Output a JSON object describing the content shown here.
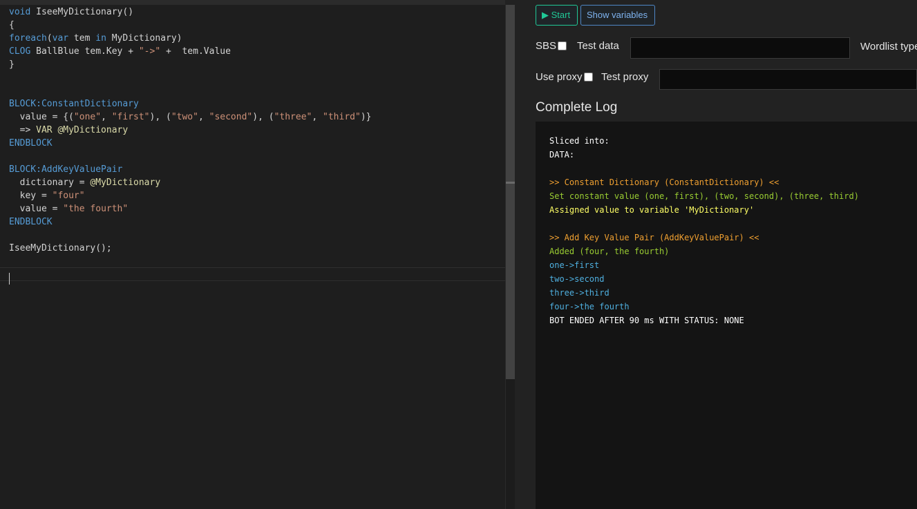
{
  "editor": {
    "lines": [
      [
        {
          "t": "void ",
          "c": "kw"
        },
        {
          "t": "IseeMyDictionary()",
          "c": "plain"
        }
      ],
      [
        {
          "t": "{",
          "c": "plain"
        }
      ],
      [
        {
          "t": "foreach",
          "c": "kw"
        },
        {
          "t": "(",
          "c": "plain"
        },
        {
          "t": "var",
          "c": "kw"
        },
        {
          "t": " tem ",
          "c": "plain"
        },
        {
          "t": "in",
          "c": "kw"
        },
        {
          "t": " MyDictionary)",
          "c": "plain"
        }
      ],
      [
        {
          "t": "CLOG",
          "c": "kw"
        },
        {
          "t": " BallBlue tem.Key + ",
          "c": "plain"
        },
        {
          "t": "\"->\"",
          "c": "str"
        },
        {
          "t": " +  tem.Value",
          "c": "plain"
        }
      ],
      [
        {
          "t": "}",
          "c": "plain"
        }
      ],
      [],
      [],
      [
        {
          "t": "BLOCK:ConstantDictionary",
          "c": "kw"
        }
      ],
      [
        {
          "t": "  value = {(",
          "c": "plain"
        },
        {
          "t": "\"one\"",
          "c": "str"
        },
        {
          "t": ", ",
          "c": "plain"
        },
        {
          "t": "\"first\"",
          "c": "str"
        },
        {
          "t": "), (",
          "c": "plain"
        },
        {
          "t": "\"two\"",
          "c": "str"
        },
        {
          "t": ", ",
          "c": "plain"
        },
        {
          "t": "\"second\"",
          "c": "str"
        },
        {
          "t": "), (",
          "c": "plain"
        },
        {
          "t": "\"three\"",
          "c": "str"
        },
        {
          "t": ", ",
          "c": "plain"
        },
        {
          "t": "\"third\"",
          "c": "str"
        },
        {
          "t": ")}",
          "c": "plain"
        }
      ],
      [
        {
          "t": "  => ",
          "c": "plain"
        },
        {
          "t": "VAR @MyDictionary",
          "c": "var"
        }
      ],
      [
        {
          "t": "ENDBLOCK",
          "c": "kw"
        }
      ],
      [],
      [
        {
          "t": "BLOCK:AddKeyValuePair",
          "c": "kw"
        }
      ],
      [
        {
          "t": "  dictionary = ",
          "c": "plain"
        },
        {
          "t": "@MyDictionary",
          "c": "var"
        }
      ],
      [
        {
          "t": "  key = ",
          "c": "plain"
        },
        {
          "t": "\"four\"",
          "c": "str"
        }
      ],
      [
        {
          "t": "  value = ",
          "c": "plain"
        },
        {
          "t": "\"the fourth\"",
          "c": "str"
        }
      ],
      [
        {
          "t": "ENDBLOCK",
          "c": "kw"
        }
      ],
      [],
      [
        {
          "t": "IseeMyDictionary();",
          "c": "plain"
        }
      ]
    ]
  },
  "toolbar": {
    "start_label": "▶ Start",
    "show_variables_label": "Show variables"
  },
  "options": {
    "sbs_label": "SBS",
    "test_data_label": "Test data",
    "test_data_value": "",
    "wordlist_type_label": "Wordlist type",
    "use_proxy_label": "Use proxy",
    "test_proxy_label": "Test proxy",
    "test_proxy_value": ""
  },
  "log": {
    "title": "Complete Log",
    "lines": [
      {
        "text": "Sliced into:",
        "color": "#ffffff"
      },
      {
        "text": "DATA:",
        "color": "#ffffff"
      },
      {
        "text": "",
        "color": "#ffffff"
      },
      {
        "text": ">> Constant Dictionary (ConstantDictionary) <<",
        "color": "#f0a030"
      },
      {
        "text": "Set constant value (one, first), (two, second), (three, third)",
        "color": "#9acd32"
      },
      {
        "text": "Assigned value to variable 'MyDictionary'",
        "color": "#ffff66"
      },
      {
        "text": "",
        "color": "#ffffff"
      },
      {
        "text": ">> Add Key Value Pair (AddKeyValuePair) <<",
        "color": "#f0a030"
      },
      {
        "text": "Added (four, the fourth)",
        "color": "#9acd32"
      },
      {
        "text": "one->first",
        "color": "#4fb0e0"
      },
      {
        "text": "two->second",
        "color": "#4fb0e0"
      },
      {
        "text": "three->third",
        "color": "#4fb0e0"
      },
      {
        "text": "four->the fourth",
        "color": "#4fb0e0"
      },
      {
        "text": "BOT ENDED AFTER 90 ms WITH STATUS: NONE",
        "color": "#ffffff"
      }
    ]
  }
}
